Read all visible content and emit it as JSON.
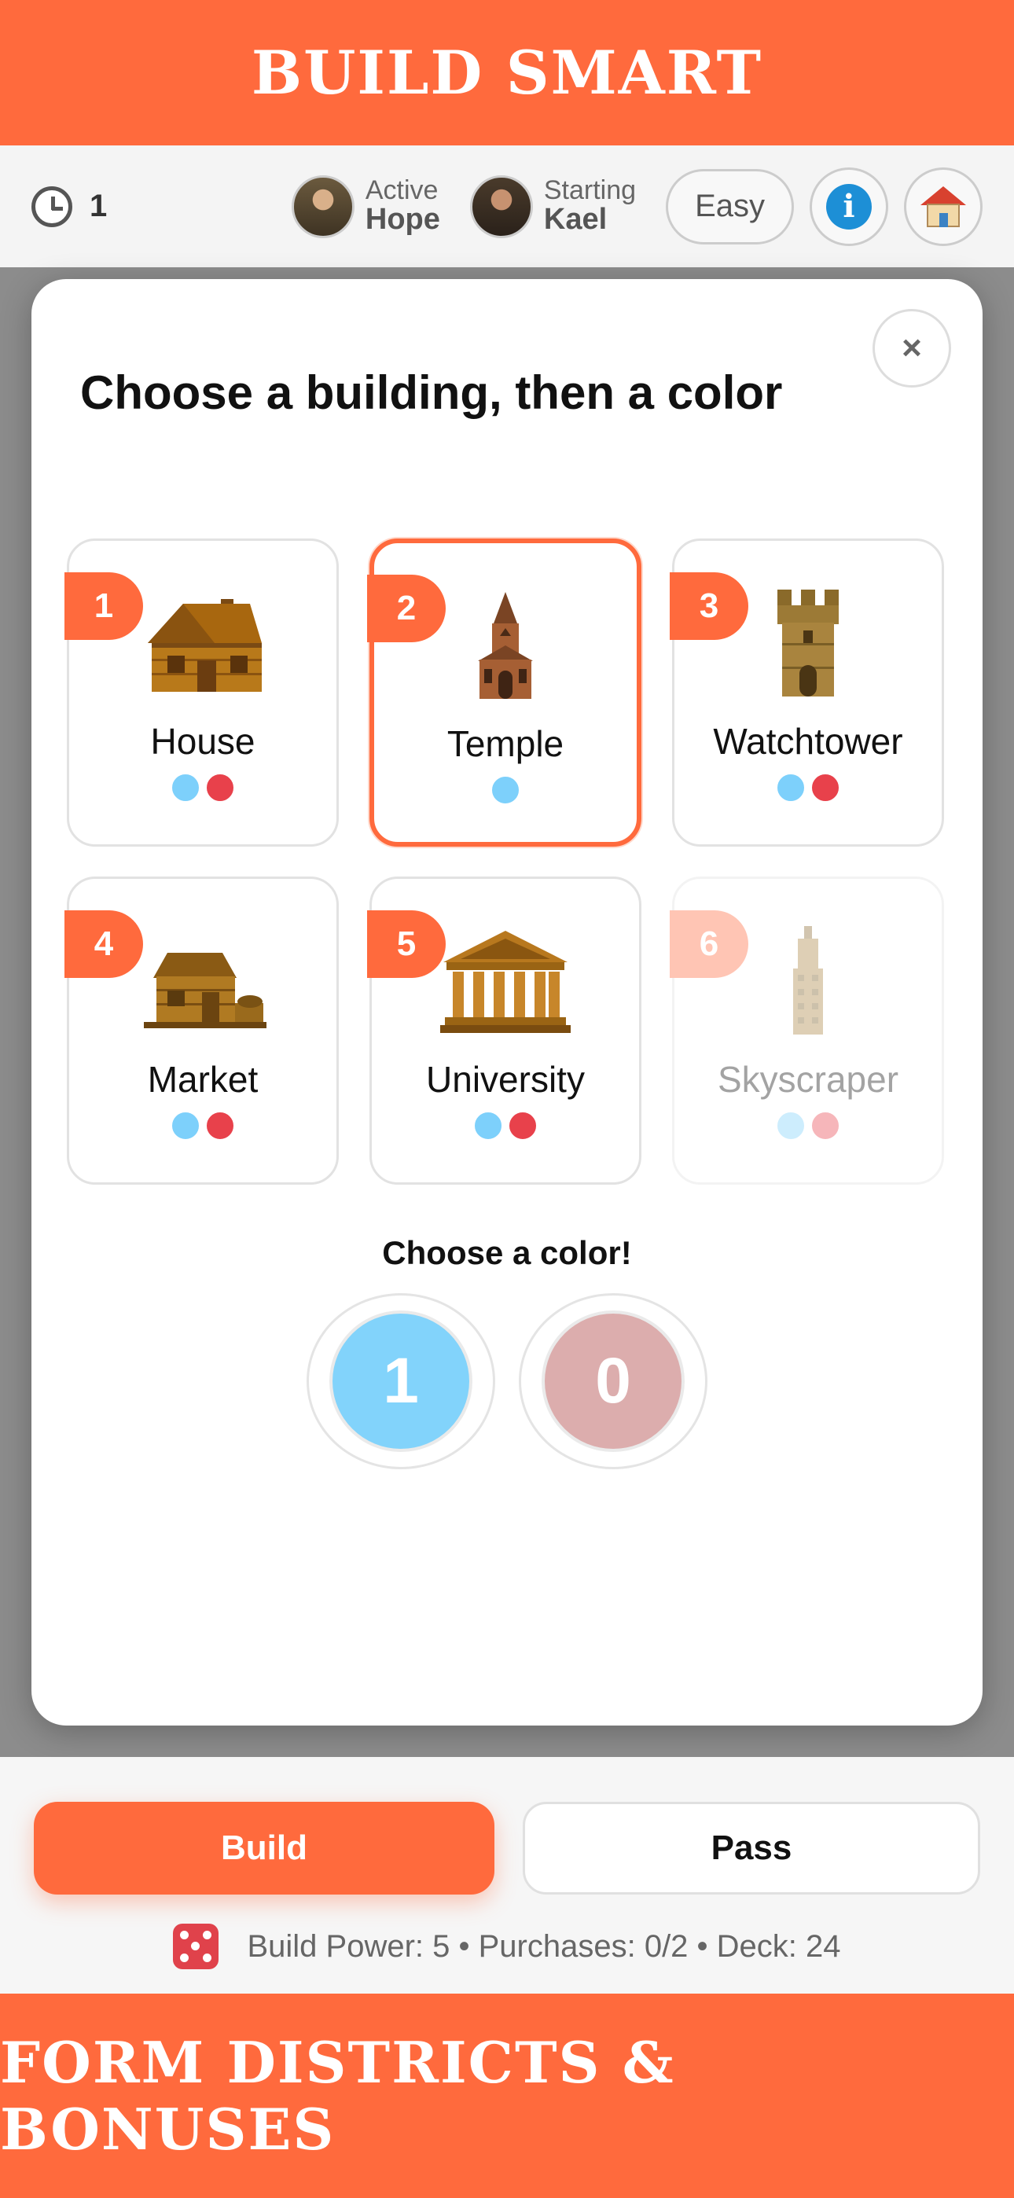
{
  "banners": {
    "top": "BUILD SMART",
    "bottom": "FORM DISTRICTS & BONUSES"
  },
  "topbar": {
    "turn_count": "1",
    "players": [
      {
        "role": "Active",
        "name": "Hope"
      },
      {
        "role": "Starting",
        "name": "Kael"
      }
    ],
    "difficulty": "Easy"
  },
  "modal": {
    "title": "Choose a building, then a color",
    "close_label": "×",
    "buildings": [
      {
        "number": "1",
        "name": "House",
        "colors": [
          "blue",
          "red"
        ],
        "selected": false,
        "disabled": false
      },
      {
        "number": "2",
        "name": "Temple",
        "colors": [
          "blue"
        ],
        "selected": true,
        "disabled": false
      },
      {
        "number": "3",
        "name": "Watchtower",
        "colors": [
          "blue",
          "red"
        ],
        "selected": false,
        "disabled": false
      },
      {
        "number": "4",
        "name": "Market",
        "colors": [
          "blue",
          "red"
        ],
        "selected": false,
        "disabled": false
      },
      {
        "number": "5",
        "name": "University",
        "colors": [
          "blue",
          "red"
        ],
        "selected": false,
        "disabled": false
      },
      {
        "number": "6",
        "name": "Skyscraper",
        "colors": [
          "blue",
          "red"
        ],
        "selected": false,
        "disabled": true
      }
    ],
    "color_heading": "Choose a color!",
    "color_options": [
      {
        "color": "blue",
        "count": "1"
      },
      {
        "color": "red",
        "count": "0"
      }
    ]
  },
  "actions": {
    "build_label": "Build",
    "pass_label": "Pass",
    "status": "Build Power: 5 • Purchases: 0/2 • Deck: 24"
  },
  "colors": {
    "accent": "#ff6a3d",
    "blue": "#7dd0fb",
    "red": "#e8414b"
  }
}
